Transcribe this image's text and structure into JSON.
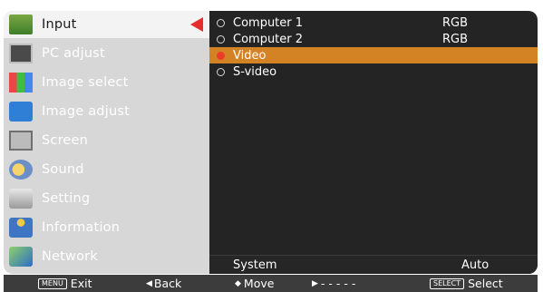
{
  "menu": {
    "items": [
      {
        "label": "Input",
        "icon": "input-icon"
      },
      {
        "label": "PC adjust",
        "icon": "pc-adjust-icon"
      },
      {
        "label": "Image select",
        "icon": "image-select-icon"
      },
      {
        "label": "Image adjust",
        "icon": "image-adjust-icon"
      },
      {
        "label": "Screen",
        "icon": "screen-icon"
      },
      {
        "label": "Sound",
        "icon": "sound-icon"
      },
      {
        "label": "Setting",
        "icon": "setting-icon"
      },
      {
        "label": "Information",
        "icon": "information-icon"
      },
      {
        "label": "Network",
        "icon": "network-icon"
      }
    ],
    "active_index": 0
  },
  "input_list": {
    "options": [
      {
        "label": "Computer 1",
        "signal": "RGB",
        "selected": false
      },
      {
        "label": "Computer 2",
        "signal": "RGB",
        "selected": false
      },
      {
        "label": "Video",
        "signal": "",
        "selected": true
      },
      {
        "label": "S-video",
        "signal": "",
        "selected": false
      }
    ]
  },
  "system": {
    "label": "System",
    "value": "Auto"
  },
  "bottom_bar": {
    "exit_tag": "MENU",
    "exit": "Exit",
    "back_arrow": "◀",
    "back": "Back",
    "move_arrow": "◆",
    "move": "Move",
    "next_arrow": "▶",
    "next": "- - - - -",
    "select_tag": "SELECT",
    "select": "Select"
  },
  "colors": {
    "selected_row": "#d38224",
    "arrow": "#e52d2d",
    "panel_dark": "#242424",
    "panel_light": "#d7d7d7"
  }
}
